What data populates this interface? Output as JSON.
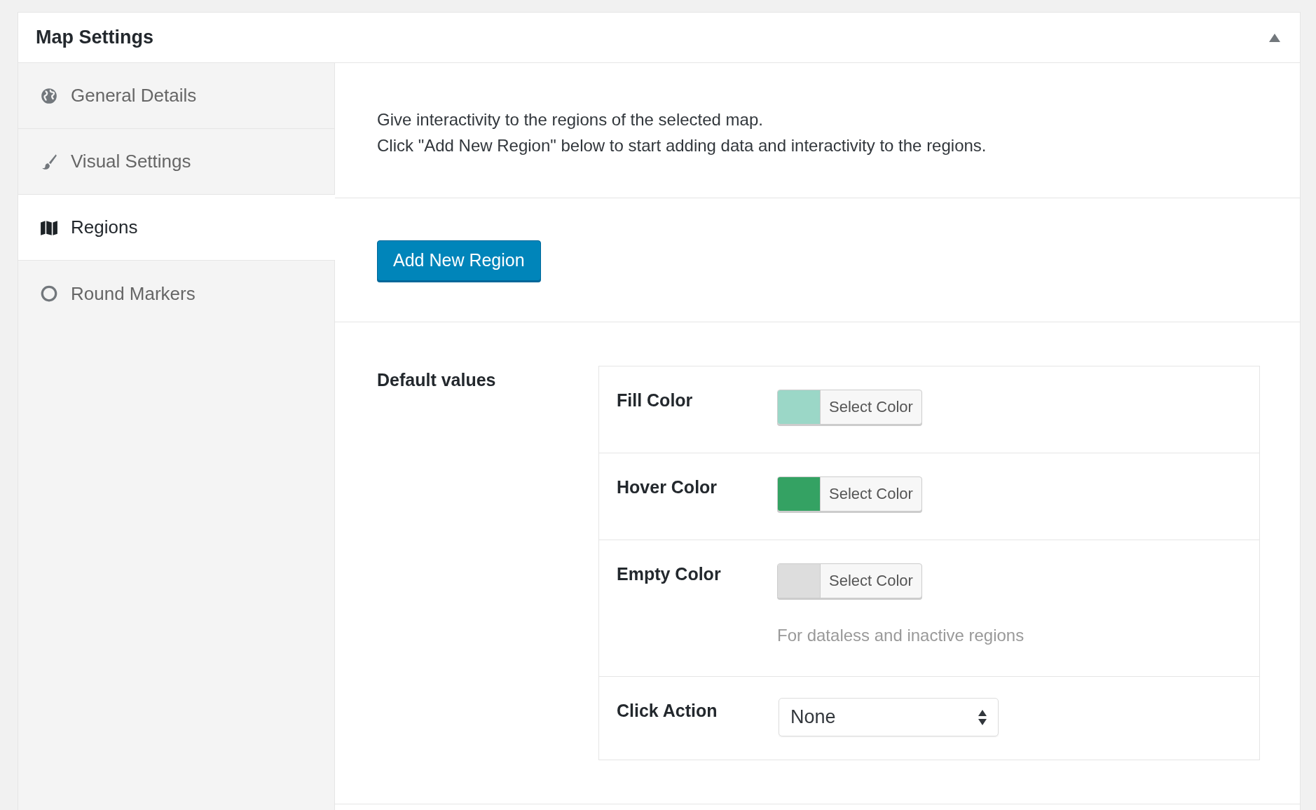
{
  "panel": {
    "title": "Map Settings",
    "expanded": true
  },
  "tabs": [
    {
      "label": "General Details",
      "kind": "globe",
      "selected": false
    },
    {
      "label": "Visual Settings",
      "kind": "brush",
      "selected": false
    },
    {
      "label": "Regions",
      "kind": "map",
      "selected": true
    },
    {
      "label": "Round Markers",
      "kind": "circle",
      "selected": false
    }
  ],
  "intro": [
    "Give interactivity to the regions of the selected map.",
    "Click \"Add New Region\" below to start adding data and interactivity to the regions."
  ],
  "add_button": "Add New Region",
  "defaults": {
    "label": "Default values",
    "fields": [
      {
        "kind": "color",
        "label": "Fill Color",
        "color": "#9bd7c7",
        "button": "Select Color"
      },
      {
        "kind": "color",
        "label": "Hover Color",
        "color": "#34a263",
        "button": "Select Color"
      },
      {
        "kind": "color",
        "label": "Empty Color",
        "color": "#dddddd",
        "button": "Select Color",
        "hint": "For dataless and inactive regions"
      },
      {
        "kind": "select",
        "label": "Click Action",
        "value": "None"
      }
    ]
  }
}
